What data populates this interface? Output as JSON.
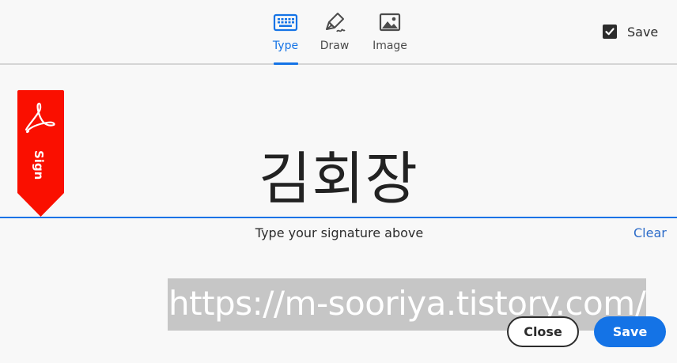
{
  "tabs": [
    {
      "label": "Type",
      "icon": "keyboard-icon",
      "active": true
    },
    {
      "label": "Draw",
      "icon": "pen-icon",
      "active": false
    },
    {
      "label": "Image",
      "icon": "image-icon",
      "active": false
    }
  ],
  "save_checkbox": {
    "label": "Save",
    "checked": true
  },
  "ribbon": {
    "label": "Sign",
    "icon": "acrobat-logo-icon",
    "color": "#fa0f00"
  },
  "signature": {
    "value": "김회장",
    "hint": "Type your signature above",
    "clear_label": "Clear"
  },
  "watermark": {
    "text": "https://m-sooriya.tistory.com/"
  },
  "buttons": {
    "close_label": "Close",
    "save_label": "Save"
  },
  "colors": {
    "accent": "#1473e6",
    "ribbon": "#fa0f00",
    "text": "#2c2c2c"
  }
}
